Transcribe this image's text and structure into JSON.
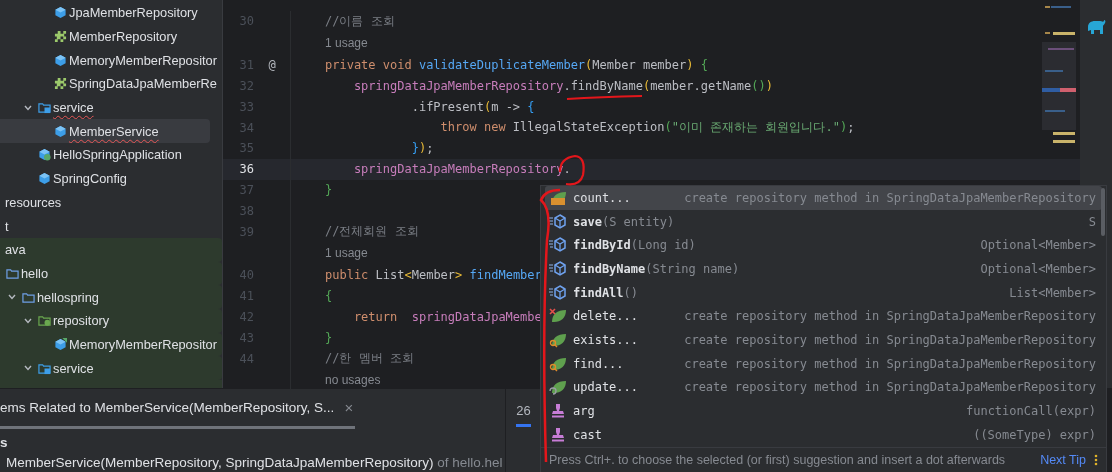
{
  "project_tree": {
    "nodes": [
      {
        "children": [
          {
            "children": [
              {
                "children": [
                  {
                    "children": [
                      {
                        "label": "JpaMemberRepository",
                        "kind": "class",
                        "selected": false
                      },
                      {
                        "label": "MemberRepository",
                        "kind": "interface",
                        "selected": false
                      },
                      {
                        "label": "MemoryMemberRepositor",
                        "kind": "class",
                        "selected": false
                      },
                      {
                        "label": "SpringDataJpaMemberRe",
                        "kind": "interface",
                        "selected": false
                      }
                    ]
                  },
                  {
                    "label": "service",
                    "kind": "service_folder",
                    "expanded": true,
                    "selected": false,
                    "error": true,
                    "children": [
                      {
                        "label": "MemberService",
                        "kind": "class",
                        "selected": true,
                        "error": true
                      }
                    ]
                  },
                  {
                    "label": "HelloSpringApplication",
                    "kind": "app",
                    "selected": false
                  },
                  {
                    "label": "SpringConfig",
                    "kind": "class",
                    "selected": false
                  }
                ]
              }
            ]
          }
        ]
      },
      {
        "label": "resources",
        "selected": false
      },
      {
        "label": "t",
        "selected": false
      },
      {
        "label": "ava",
        "selected": false,
        "test": true
      },
      {
        "children": [
          {
            "label": "hello",
            "kind": "folder",
            "selected": false,
            "test": true,
            "children": [
              {
                "label": "hellospring",
                "kind": "folder",
                "expanded": true,
                "selected": false,
                "test": true,
                "children": [
                  {
                    "label": "repository",
                    "kind": "repo_folder",
                    "expanded": true,
                    "selected": false,
                    "test": true,
                    "children": [
                      {
                        "label": "MemoryMemberRepositor",
                        "kind": "test_class",
                        "selected": false,
                        "test": true
                      }
                    ]
                  },
                  {
                    "label": "service",
                    "kind": "service_folder",
                    "expanded": true,
                    "selected": false,
                    "test": true
                  }
                ]
              }
            ]
          }
        ]
      }
    ]
  },
  "editor": {
    "lines": [
      {
        "kind": "code",
        "number": "30",
        "current": false,
        "tokens": [
          {
            "kind": "comment",
            "text": "//이름 조회"
          }
        ]
      },
      {
        "kind": "inlay",
        "text": "1 usage"
      },
      {
        "kind": "code",
        "number": "31",
        "marker": "@",
        "current": false,
        "tokens": [
          {
            "kind": "kw",
            "text": "private void "
          },
          {
            "kind": "decl",
            "text": "validateDuplicateMember"
          },
          {
            "kind": "b1",
            "text": "("
          },
          {
            "kind": "plain",
            "text": "Member member"
          },
          {
            "kind": "b1",
            "text": ")"
          },
          {
            "kind": "b2",
            "text": " {"
          }
        ]
      },
      {
        "kind": "code",
        "number": "32",
        "current": false,
        "tokens": [
          {
            "kind": "field",
            "text": "    springDataJpaMemberRepository"
          },
          {
            "kind": "plain",
            "text": ".findByName"
          },
          {
            "kind": "b1",
            "text": "("
          },
          {
            "kind": "plain",
            "text": "member.getName"
          },
          {
            "kind": "b2",
            "text": "()"
          },
          {
            "kind": "b1",
            "text": ")"
          }
        ]
      },
      {
        "kind": "code",
        "number": "33",
        "current": false,
        "tokens": [
          {
            "kind": "plain",
            "text": "            .ifPresent"
          },
          {
            "kind": "b1",
            "text": "("
          },
          {
            "kind": "plain",
            "text": "m -> "
          },
          {
            "kind": "b3",
            "text": "{"
          }
        ]
      },
      {
        "kind": "code",
        "number": "34",
        "current": false,
        "tokens": [
          {
            "kind": "kw",
            "text": "                throw new "
          },
          {
            "kind": "plain",
            "text": "IllegalStateException"
          },
          {
            "kind": "b2",
            "text": "("
          },
          {
            "kind": "string",
            "text": "\"이미 존재하는 회원입니다.\""
          },
          {
            "kind": "b2",
            "text": ")"
          },
          {
            "kind": "plain",
            "text": ";"
          }
        ]
      },
      {
        "kind": "code",
        "number": "35",
        "current": false,
        "tokens": [
          {
            "kind": "b3",
            "text": "            }"
          },
          {
            "kind": "b1",
            "text": ")"
          },
          {
            "kind": "plain",
            "text": ";"
          }
        ]
      },
      {
        "kind": "code",
        "number": "36",
        "current": true,
        "tokens": [
          {
            "kind": "field",
            "text": "    springDataJpaMemberRepository"
          },
          {
            "kind": "plain",
            "text": "."
          }
        ]
      },
      {
        "kind": "code",
        "number": "37",
        "current": false,
        "tokens": [
          {
            "kind": "b2",
            "text": "}"
          }
        ]
      },
      {
        "kind": "code",
        "number": "38",
        "current": false
      },
      {
        "kind": "code",
        "number": "39",
        "current": false,
        "tokens": [
          {
            "kind": "comment",
            "text": "//전체회원 조회"
          }
        ]
      },
      {
        "kind": "inlay",
        "text": "1 usage"
      },
      {
        "kind": "code",
        "number": "40",
        "current": false,
        "tokens": [
          {
            "kind": "kw",
            "text": "public "
          },
          {
            "kind": "plain",
            "text": "List"
          },
          {
            "kind": "b1",
            "text": "<"
          },
          {
            "kind": "plain",
            "text": "Member"
          },
          {
            "kind": "b1",
            "text": ">"
          },
          {
            "kind": "decl",
            "text": " findMember"
          }
        ]
      },
      {
        "kind": "code",
        "number": "41",
        "current": false,
        "tokens": [
          {
            "kind": "b2",
            "text": "{"
          }
        ]
      },
      {
        "kind": "code",
        "number": "42",
        "current": false,
        "tokens": [
          {
            "kind": "kw",
            "text": "    return  "
          },
          {
            "kind": "field",
            "text": "springDataJpaMembe"
          }
        ]
      },
      {
        "kind": "code",
        "number": "43",
        "current": false,
        "tokens": [
          {
            "kind": "b2",
            "text": "}"
          }
        ]
      },
      {
        "kind": "code",
        "number": "44",
        "current": false,
        "tokens": [
          {
            "kind": "comment",
            "text": "//한 멤버 조회"
          }
        ]
      },
      {
        "kind": "inlay",
        "text": "no usages"
      }
    ]
  },
  "completion_popup": {
    "items": [
      {
        "kind": "spring_count",
        "name": "count...",
        "tail": "create repository method in SpringDataJpaMemberRepository",
        "selected": true,
        "bold": false
      },
      {
        "kind": "method",
        "name": "save",
        "params": "(S entity)",
        "tail": "S",
        "selected": false,
        "bold": true
      },
      {
        "kind": "method",
        "name": "findById",
        "params": "(Long id)",
        "tail": "Optional<Member>",
        "selected": false,
        "bold": true
      },
      {
        "kind": "method",
        "name": "findByName",
        "params": "(String name)",
        "tail": "Optional<Member>",
        "selected": false,
        "bold": true
      },
      {
        "kind": "method",
        "name": "findAll",
        "params": "()",
        "tail": "List<Member>",
        "selected": false,
        "bold": true
      },
      {
        "kind": "spring_delete",
        "name": "delete...",
        "tail": "create repository method in SpringDataJpaMemberRepository",
        "selected": false,
        "bold": false
      },
      {
        "kind": "spring_find",
        "name": "exists...",
        "tail": "create repository method in SpringDataJpaMemberRepository",
        "selected": false,
        "bold": false
      },
      {
        "kind": "spring_find",
        "name": "find...",
        "tail": "create repository method in SpringDataJpaMemberRepository",
        "selected": false,
        "bold": false
      },
      {
        "kind": "spring_update",
        "name": "update...",
        "tail": "create repository method in SpringDataJpaMemberRepository",
        "selected": false,
        "bold": false
      },
      {
        "kind": "template",
        "name": "arg",
        "tail": "functionCall(expr)",
        "selected": false,
        "bold": false
      },
      {
        "kind": "template",
        "name": "cast",
        "tail": "((SomeType) expr)",
        "selected": false,
        "bold": false
      }
    ],
    "hint": "Press Ctrl+. to choose the selected (or first) suggestion and insert a dot afterwards",
    "link": "Next Tip"
  },
  "bottom_panel": {
    "tab": {
      "label": "ems Related to MemberService(MemberRepository, S...",
      "close": "×"
    },
    "heading": "s",
    "result": {
      "signature": "MemberService(MemberRepository, SpringDataJpaMemberRepository)",
      "location": " of hello.hel"
    }
  },
  "side_tab": {
    "label": "26"
  }
}
